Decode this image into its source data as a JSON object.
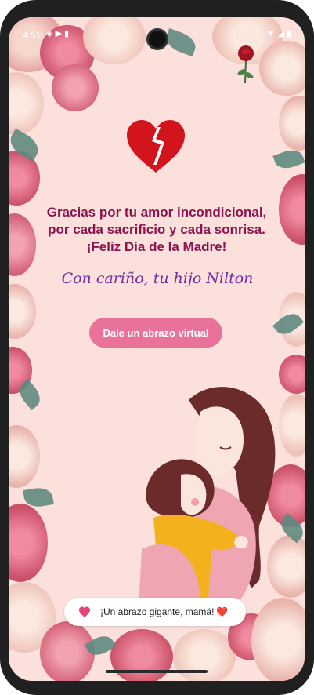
{
  "status_bar": {
    "time": "4:51",
    "left_icons": [
      "shield-icon",
      "play-icon",
      "sim-icon"
    ],
    "right_icons": [
      "wifi-icon",
      "signal-icon",
      "battery-icon"
    ]
  },
  "card": {
    "message_lines": [
      "Gracias por tu amor incondicional,",
      "por cada sacrificio y cada sonrisa.",
      "¡Feliz Día de la Madre!"
    ],
    "signature": "Con cariño, tu hijo Nilton",
    "hug_button_label": "Dale un abrazo virtual"
  },
  "toast": {
    "text": "¡Un abrazo gigante, mamá!",
    "trailing_emoji": "❤️"
  },
  "colors": {
    "background": "#fbe0dc",
    "message": "#8b1450",
    "signature": "#6b2ea0",
    "button": "#e8729a",
    "heart": "#d2141c"
  }
}
